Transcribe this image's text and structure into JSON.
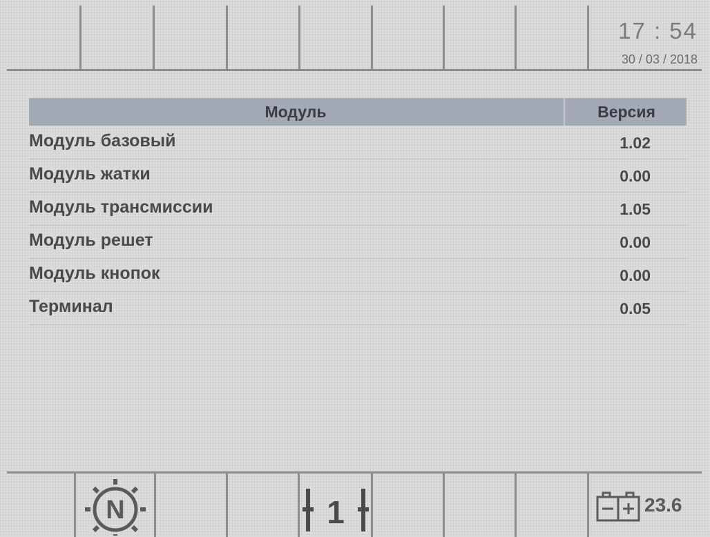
{
  "header": {
    "time": "17 : 54",
    "date": "30 / 03 / 2018"
  },
  "table": {
    "col_module": "Модуль",
    "col_version": "Версия",
    "rows": [
      {
        "name": "Модуль базовый",
        "version": "1.02"
      },
      {
        "name": "Модуль жатки",
        "version": "0.00"
      },
      {
        "name": "Модуль трансмиссии",
        "version": "1.05"
      },
      {
        "name": "Модуль решет",
        "version": "0.00"
      },
      {
        "name": "Модуль кнопок",
        "version": "0.00"
      },
      {
        "name": "Терминал",
        "version": "0.05"
      }
    ]
  },
  "footer": {
    "gear_letter": "N",
    "gear_number": "1",
    "battery_voltage": "23.6",
    "icons": [
      "neutral-gear-icon",
      "gear-position-icon",
      "battery-icon"
    ]
  }
}
